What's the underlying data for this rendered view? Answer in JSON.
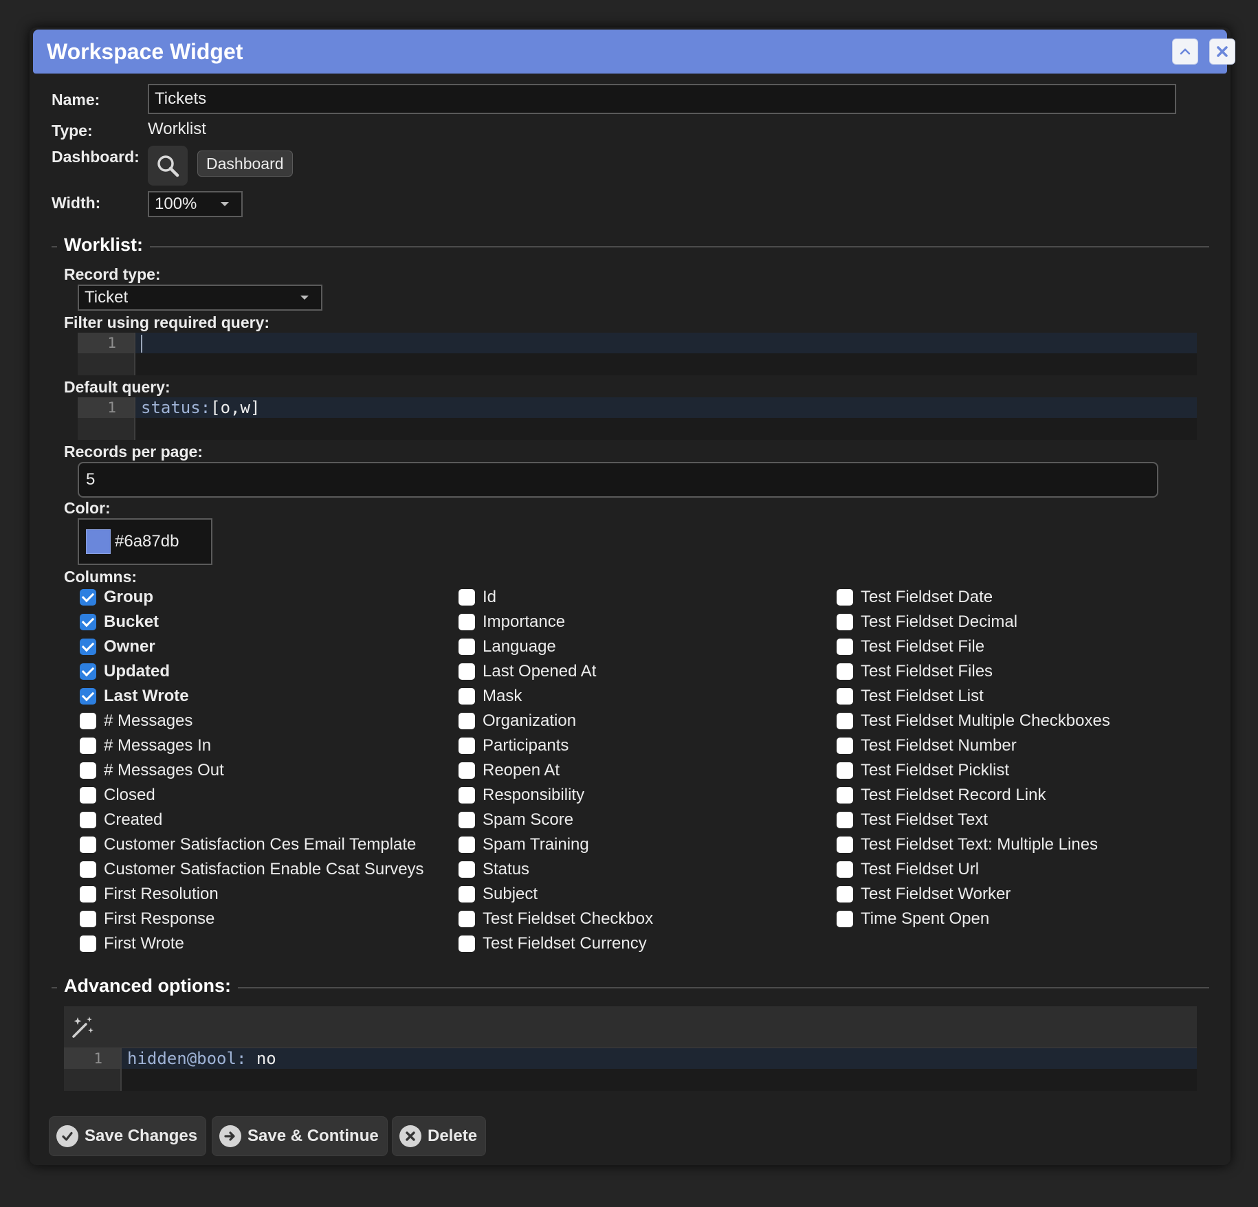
{
  "dialog": {
    "title": "Workspace Widget",
    "accent_color": "#6a87db",
    "collapse_icon": "chevron-up-icon",
    "close_icon": "close-icon"
  },
  "form": {
    "name_label": "Name:",
    "name_value": "Tickets",
    "type_label": "Type:",
    "type_value": "Worklist",
    "dashboard_label": "Dashboard:",
    "dashboard_search_icon": "search-icon",
    "dashboard_chip": "Dashboard",
    "width_label": "Width:",
    "width_value": "100%"
  },
  "worklist": {
    "section_title": "Worklist:",
    "record_type_label": "Record type:",
    "record_type_value": "Ticket",
    "filter_label": "Filter using required query:",
    "filter_line_number": "1",
    "filter_value": "",
    "default_query_label": "Default query:",
    "default_query_line_number": "1",
    "default_query_key": "status:",
    "default_query_value": "[o,w]",
    "records_per_page_label": "Records per page:",
    "records_per_page_value": "5",
    "color_label": "Color:",
    "color_value": "#6a87db",
    "columns_label": "Columns:",
    "columns": [
      [
        {
          "label": "Group",
          "checked": true
        },
        {
          "label": "Bucket",
          "checked": true
        },
        {
          "label": "Owner",
          "checked": true
        },
        {
          "label": "Updated",
          "checked": true
        },
        {
          "label": "Last Wrote",
          "checked": true
        },
        {
          "label": "# Messages",
          "checked": false
        },
        {
          "label": "# Messages In",
          "checked": false
        },
        {
          "label": "# Messages Out",
          "checked": false
        },
        {
          "label": "Closed",
          "checked": false
        },
        {
          "label": "Created",
          "checked": false
        },
        {
          "label": "Customer Satisfaction Ces Email Template",
          "checked": false
        },
        {
          "label": "Customer Satisfaction Enable Csat Surveys",
          "checked": false
        },
        {
          "label": "First Resolution",
          "checked": false
        },
        {
          "label": "First Response",
          "checked": false
        },
        {
          "label": "First Wrote",
          "checked": false
        }
      ],
      [
        {
          "label": "Id",
          "checked": false
        },
        {
          "label": "Importance",
          "checked": false
        },
        {
          "label": "Language",
          "checked": false
        },
        {
          "label": "Last Opened At",
          "checked": false
        },
        {
          "label": "Mask",
          "checked": false
        },
        {
          "label": "Organization",
          "checked": false
        },
        {
          "label": "Participants",
          "checked": false
        },
        {
          "label": "Reopen At",
          "checked": false
        },
        {
          "label": "Responsibility",
          "checked": false
        },
        {
          "label": "Spam Score",
          "checked": false
        },
        {
          "label": "Spam Training",
          "checked": false
        },
        {
          "label": "Status",
          "checked": false
        },
        {
          "label": "Subject",
          "checked": false
        },
        {
          "label": "Test Fieldset Checkbox",
          "checked": false
        },
        {
          "label": "Test Fieldset Currency",
          "checked": false
        }
      ],
      [
        {
          "label": "Test Fieldset Date",
          "checked": false
        },
        {
          "label": "Test Fieldset Decimal",
          "checked": false
        },
        {
          "label": "Test Fieldset File",
          "checked": false
        },
        {
          "label": "Test Fieldset Files",
          "checked": false
        },
        {
          "label": "Test Fieldset List",
          "checked": false
        },
        {
          "label": "Test Fieldset Multiple Checkboxes",
          "checked": false
        },
        {
          "label": "Test Fieldset Number",
          "checked": false
        },
        {
          "label": "Test Fieldset Picklist",
          "checked": false
        },
        {
          "label": "Test Fieldset Record Link",
          "checked": false
        },
        {
          "label": "Test Fieldset Text",
          "checked": false
        },
        {
          "label": "Test Fieldset Text: Multiple Lines",
          "checked": false
        },
        {
          "label": "Test Fieldset Url",
          "checked": false
        },
        {
          "label": "Test Fieldset Worker",
          "checked": false
        },
        {
          "label": "Time Spent Open",
          "checked": false
        }
      ]
    ]
  },
  "advanced": {
    "section_title": "Advanced options:",
    "magic_icon": "magic-wand-icon",
    "line_number": "1",
    "code_key": "hidden@bool:",
    "code_value": " no"
  },
  "buttons": {
    "save_changes": "Save Changes",
    "save_continue": "Save & Continue",
    "delete": "Delete"
  }
}
